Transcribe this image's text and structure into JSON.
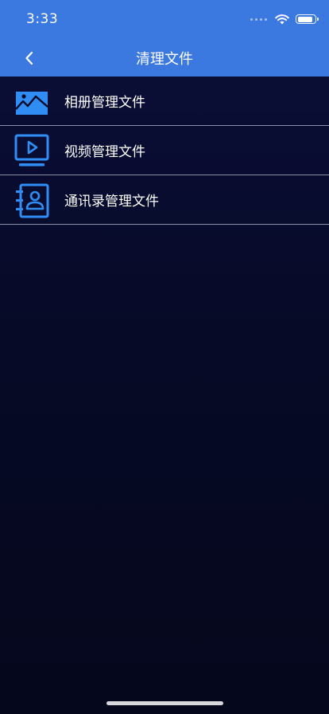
{
  "status_bar": {
    "time": "3:33",
    "battery_level": 0.9
  },
  "nav": {
    "title": "清理文件",
    "back_icon": "chevron-left-icon"
  },
  "items": [
    {
      "label": "相册管理文件",
      "icon": "photo-album-icon"
    },
    {
      "label": "视频管理文件",
      "icon": "video-player-icon"
    },
    {
      "label": "通讯录管理文件",
      "icon": "contact-book-icon"
    }
  ],
  "colors": {
    "header": "#3b78e0",
    "icon_accent": "#2f8df5",
    "background": "#070a27",
    "divider": "#8b90a8"
  }
}
